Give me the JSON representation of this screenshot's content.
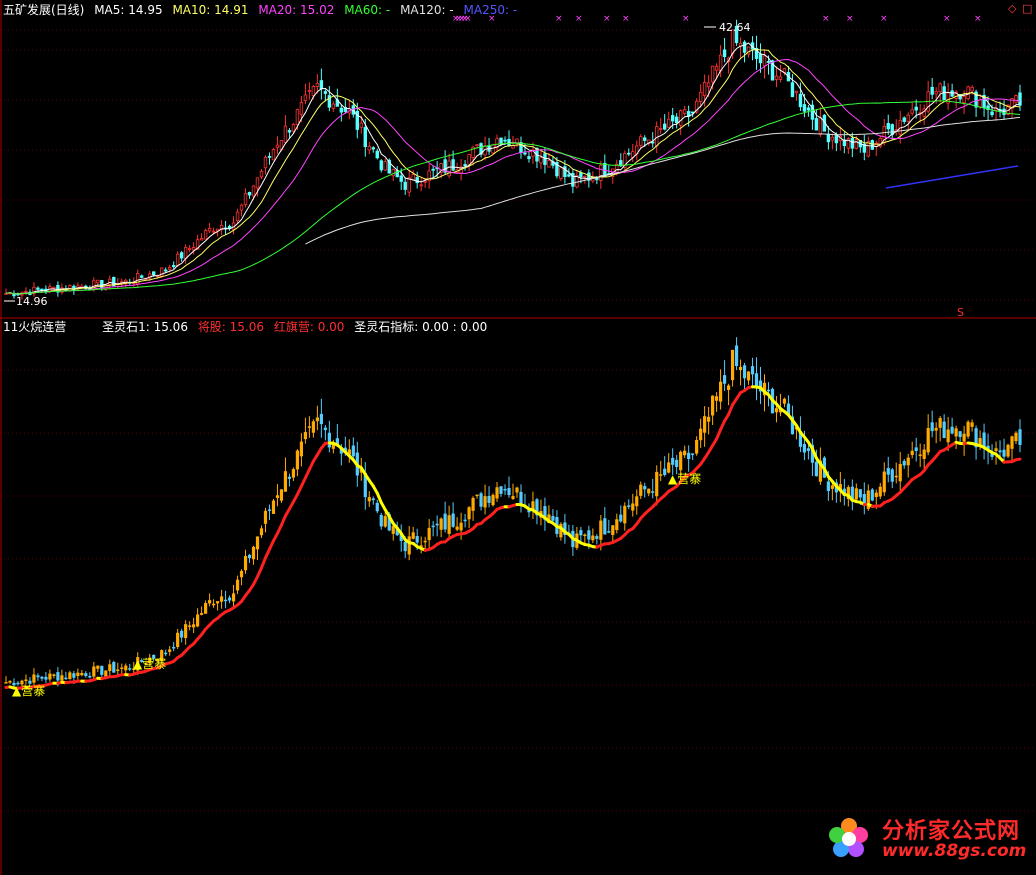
{
  "top_panel": {
    "name": "五矿发展(日线)",
    "ma5": "MA5: 14.95",
    "ma10": "MA10: 14.91",
    "ma20": "MA20: 15.02",
    "ma60": "MA60: -",
    "ma120": "MA120: -",
    "ma250": "MA250: -",
    "high_label": "42.64",
    "low_label": "14.96",
    "signal_s": "S",
    "colors": {
      "ma5": "#ffffff",
      "ma10": "#ffff66",
      "ma20": "#ff44ff",
      "ma60": "#33ff33",
      "ma120": "#e0e0e0",
      "ma250": "#3333ff"
    }
  },
  "bottom_panel": {
    "name": "11火烷连营",
    "sls1": "圣灵石1: 15.06",
    "jiangu": "将股: 15.06",
    "hongqi": "红旗营: 0.00",
    "slsindex": "圣灵石指标: 0.00 : 0.00",
    "camp_label": "营寨",
    "colors": {
      "up_line": "#ff2020",
      "down_line": "#ffff00",
      "candle_up": "#ffaa00",
      "candle_down": "#55ccff"
    }
  },
  "corner_icons": [
    "diamond-icon",
    "square-icon"
  ],
  "watermark": {
    "cn": "分析家公式网",
    "url": "www.88gs.com"
  },
  "chart_data": {
    "type": "candlestick",
    "title": "五矿发展(日线)",
    "low": 14.96,
    "high": 42.64,
    "ma5_last": 14.95,
    "ma10_last": 14.91,
    "ma20_last": 15.02,
    "indicator_last": 15.06
  }
}
